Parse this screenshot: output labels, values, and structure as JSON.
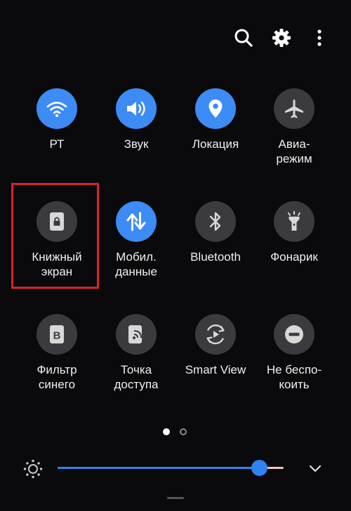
{
  "header": {
    "icons": [
      "search-icon",
      "gear-icon",
      "more-vertical-icon"
    ]
  },
  "tiles": [
    {
      "label": "РТ",
      "icon": "wifi-icon",
      "state": "on"
    },
    {
      "label": "Звук",
      "icon": "volume-icon",
      "state": "on"
    },
    {
      "label": "Локация",
      "icon": "location-pin-icon",
      "state": "on"
    },
    {
      "label": "Авиа-\nрежим",
      "icon": "airplane-icon",
      "state": "off"
    },
    {
      "label": "Книжный\nэкран",
      "icon": "portrait-lock-icon",
      "state": "off"
    },
    {
      "label": "Мобил.\nданные",
      "icon": "mobile-data-icon",
      "state": "on"
    },
    {
      "label": "Bluetooth",
      "icon": "bluetooth-icon",
      "state": "off"
    },
    {
      "label": "Фонарик",
      "icon": "flashlight-icon",
      "state": "off"
    },
    {
      "label": "Фильтр\nсинего",
      "icon": "blue-light-filter-icon",
      "state": "off"
    },
    {
      "label": "Точка\nдоступа",
      "icon": "hotspot-icon",
      "state": "off"
    },
    {
      "label": "Smart View",
      "icon": "smart-view-icon",
      "state": "off"
    },
    {
      "label": "Не беспо-\nкоить",
      "icon": "do-not-disturb-icon",
      "state": "off"
    }
  ],
  "pagination": {
    "pages": 2,
    "current": 1
  },
  "brightness": {
    "level": 0.89,
    "icon": "brightness-sun-icon"
  },
  "colors": {
    "active": "#3d8bf5",
    "inactive": "#3b3b3f",
    "highlight": "#d8232a",
    "background": "#0a0a0c"
  }
}
